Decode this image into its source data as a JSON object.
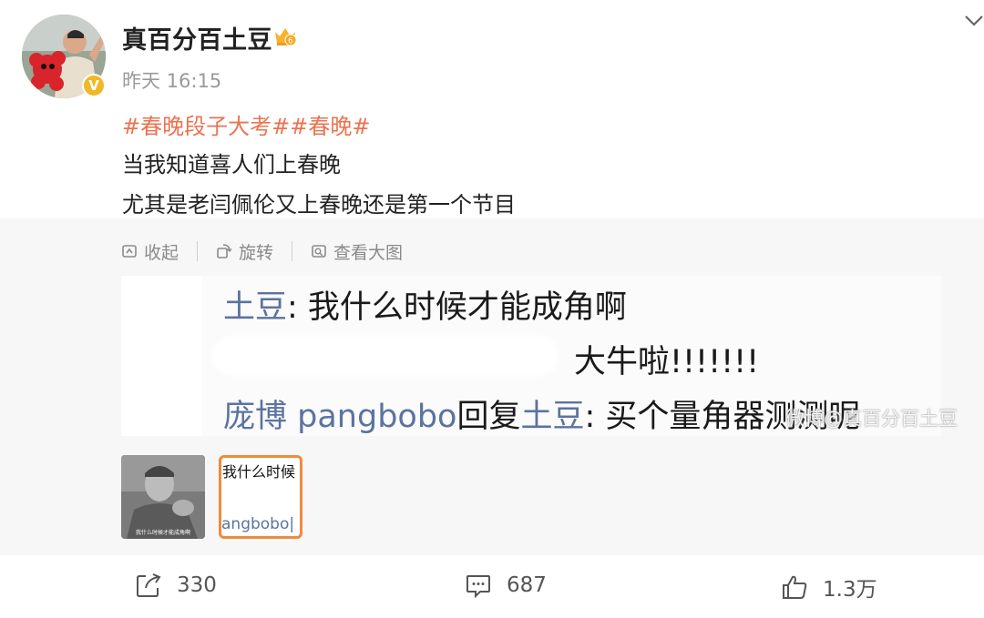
{
  "post": {
    "username": "真百分百土豆",
    "timestamp": "昨天 16:15",
    "verified_mark": "V",
    "hashtags": "#春晚段子大考##春晚#",
    "lines": [
      "当我知道喜人们上春晚",
      "尤其是老闫佩伦又上春晚还是第一个节目"
    ]
  },
  "media_toolbar": {
    "collapse": "收起",
    "rotate": "旋转",
    "view_large": "查看大图"
  },
  "image": {
    "line1_name": "土豆",
    "line1_text": ": 我什么时候才能成角啊",
    "line2_text": "大牛啦!!!!!!!",
    "line3_name": "庞博 pangbobo",
    "line3_mid": "回复",
    "line3_name2": "土豆",
    "line3_text": ": 买个量角器测测呢",
    "watermark": "微博@真百分百土豆"
  },
  "thumbnails": {
    "thumb2_line1": "我什么时候",
    "thumb2_line2": "angbobo|"
  },
  "actions": {
    "share_count": "330",
    "comment_count": "687",
    "like_count": "1.3万"
  },
  "colors": {
    "hashtag": "#eb7350",
    "name_blue": "#5b739f",
    "selected_border": "#f08a3c"
  }
}
